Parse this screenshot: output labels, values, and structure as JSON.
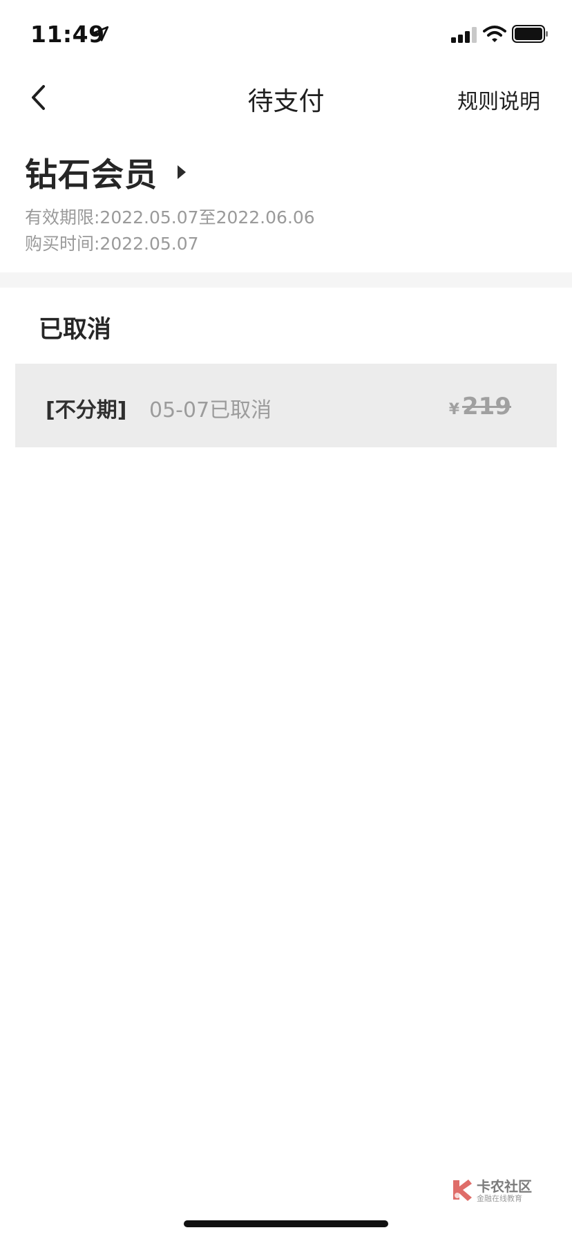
{
  "status_bar": {
    "time": "11:49"
  },
  "nav": {
    "title": "待支付",
    "rules": "规则说明"
  },
  "membership": {
    "title": "钻石会员",
    "validity": "有效期限:2022.05.07至2022.06.06",
    "purchase_time": "购买时间:2022.05.07"
  },
  "order_section": {
    "title": "已取消",
    "rows": [
      {
        "plan": "[不分期]",
        "status": "05-07已取消",
        "currency": "¥",
        "price": "219"
      }
    ]
  },
  "watermark": {
    "title": "卡农社区",
    "subtitle": "金融在线教育"
  },
  "colors": {
    "background": "#ffffff",
    "section_gap": "#f5f5f5",
    "row_background": "#ececec",
    "muted_text": "#9a9a9a",
    "watermark_red": "#d9534f"
  },
  "icons": [
    "location-arrow-icon",
    "cellular-signal-icon",
    "wifi-icon",
    "battery-icon",
    "back-chevron-icon",
    "caret-right-icon",
    "kanong-logo-icon"
  ]
}
